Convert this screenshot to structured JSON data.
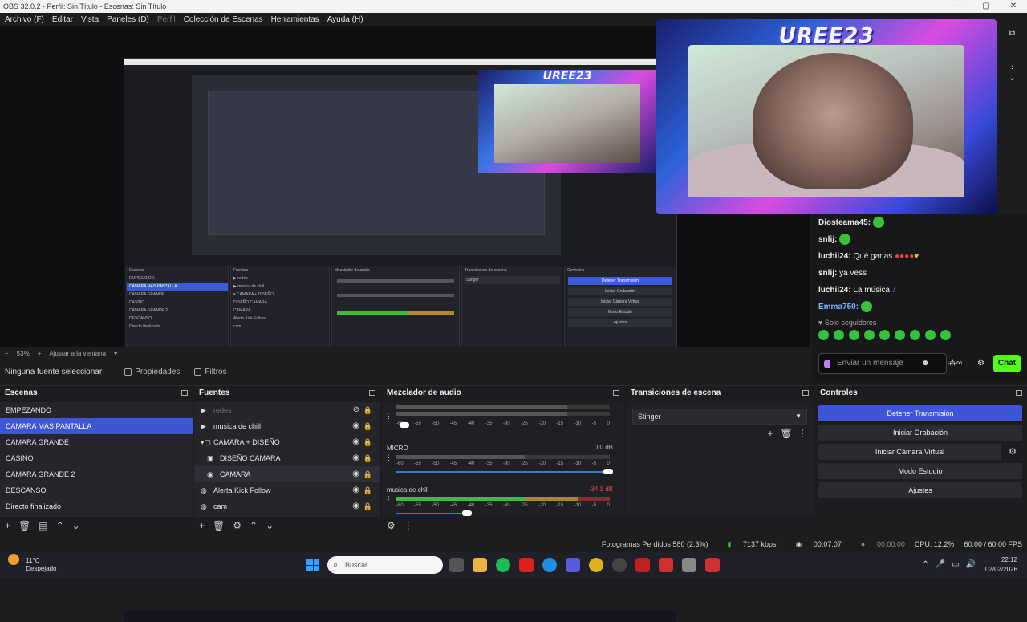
{
  "window": {
    "title": "OBS 32.0.2 - Perfil: Sin Título - Escenas: Sin Título"
  },
  "menu": [
    "Archivo (F)",
    "Editar",
    "Vista",
    "Paneles (D)",
    "Perfil",
    "Colección de Escenas",
    "Herramientas",
    "Ayuda (H)"
  ],
  "overlay": {
    "brand": "UREE23"
  },
  "chat": {
    "messages": [
      {
        "user": "Diosteama45:",
        "text": ""
      },
      {
        "user": "snlij:",
        "text": ""
      },
      {
        "user": "luchii24:",
        "text": "Qué ganas"
      },
      {
        "user": "snlij:",
        "text": "ya vess"
      },
      {
        "user": "luchii24:",
        "text": "La música"
      },
      {
        "user": "Emma750:",
        "text": ""
      }
    ],
    "notice": "♥ Solo seguidores",
    "placeholder": "Enviar un mensaje",
    "send": "Chat"
  },
  "zoom": {
    "value": "53%",
    "fit": "Ajustar a la ventana"
  },
  "source_toolbar": {
    "none": "Ninguna fuente seleccionar",
    "properties": "Propiedades",
    "filters": "Filtros"
  },
  "docks": {
    "scenes": "Escenas",
    "sources": "Fuentes",
    "mixer": "Mezclador de audio",
    "transitions": "Transiciones de escena",
    "controls": "Controles"
  },
  "scenes": [
    "EMPEZANDO",
    "CAMARA MAS PANTALLA",
    "CAMARA GRANDE",
    "CASINO",
    "CAMARA GRANDE 2",
    "DESCANSO",
    "Directo finalizado"
  ],
  "selected_scene_index": 1,
  "sources": [
    {
      "name": "redes",
      "icon": "▶",
      "dim": true
    },
    {
      "name": "musica de chill",
      "icon": "▶",
      "dim": false
    },
    {
      "name": "CAMARA + DISEÑO",
      "icon": "▾▢",
      "dim": false
    },
    {
      "name": "DISEÑO CAMARA",
      "icon": "▣",
      "dim": false
    },
    {
      "name": "CAMARA",
      "icon": "◉",
      "dim": false
    },
    {
      "name": "Alerta Kick Follow",
      "icon": "◍",
      "dim": false
    },
    {
      "name": "cam",
      "icon": "◍",
      "dim": false
    }
  ],
  "mixer": {
    "scale": [
      "-60",
      "-55",
      "-50",
      "-45",
      "-40",
      "-35",
      "-30",
      "-25",
      "-20",
      "-15",
      "-10",
      "-5",
      "0"
    ],
    "tracks": [
      {
        "name": "",
        "db": ""
      },
      {
        "name": "MICRO",
        "db": "0.0 dB"
      },
      {
        "name": "musica de chill",
        "db": "-34.1 dB"
      }
    ]
  },
  "transitions": {
    "selected": "Stinger"
  },
  "controls": {
    "stop_stream": "Detener Transmisión",
    "start_record": "Iniciar Grabación",
    "virtual_cam": "Iniciar Cámara Virtual",
    "studio": "Modo Estudio",
    "settings": "Ajustes"
  },
  "status": {
    "dropped": "Fotogramas Perdidos 580 (2.3%)",
    "bitrate": "7137 kbps",
    "live": "00:07:07",
    "rec": "00:00:00",
    "cpu": "CPU: 12.2%",
    "fps": "60.00 / 60.00 FPS"
  },
  "taskbar": {
    "temp": "11°C",
    "weather": "Despejado",
    "search": "Buscar",
    "time": "22:12",
    "date": "02/02/2026"
  }
}
